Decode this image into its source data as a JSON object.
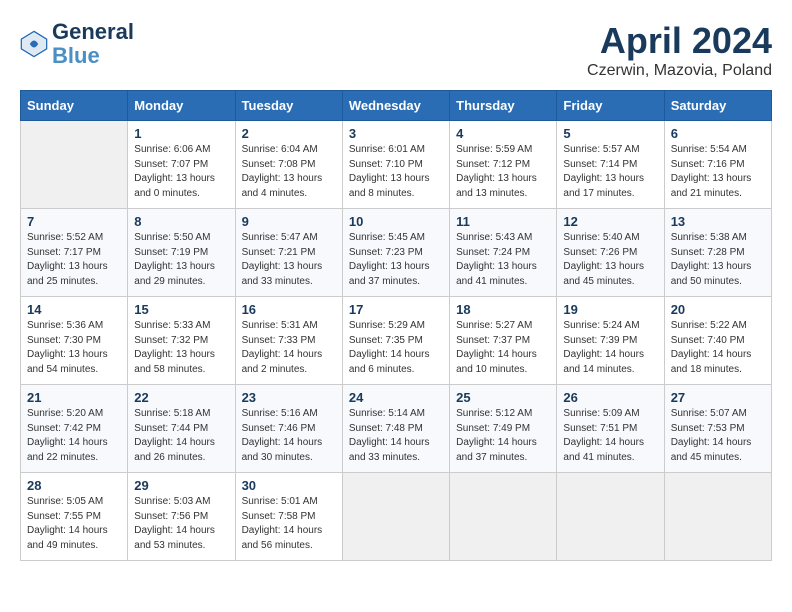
{
  "header": {
    "logo_general": "General",
    "logo_blue": "Blue",
    "month_title": "April 2024",
    "location": "Czerwin, Mazovia, Poland"
  },
  "columns": [
    "Sunday",
    "Monday",
    "Tuesday",
    "Wednesday",
    "Thursday",
    "Friday",
    "Saturday"
  ],
  "weeks": [
    [
      {
        "day": "",
        "info": ""
      },
      {
        "day": "1",
        "info": "Sunrise: 6:06 AM\nSunset: 7:07 PM\nDaylight: 13 hours\nand 0 minutes."
      },
      {
        "day": "2",
        "info": "Sunrise: 6:04 AM\nSunset: 7:08 PM\nDaylight: 13 hours\nand 4 minutes."
      },
      {
        "day": "3",
        "info": "Sunrise: 6:01 AM\nSunset: 7:10 PM\nDaylight: 13 hours\nand 8 minutes."
      },
      {
        "day": "4",
        "info": "Sunrise: 5:59 AM\nSunset: 7:12 PM\nDaylight: 13 hours\nand 13 minutes."
      },
      {
        "day": "5",
        "info": "Sunrise: 5:57 AM\nSunset: 7:14 PM\nDaylight: 13 hours\nand 17 minutes."
      },
      {
        "day": "6",
        "info": "Sunrise: 5:54 AM\nSunset: 7:16 PM\nDaylight: 13 hours\nand 21 minutes."
      }
    ],
    [
      {
        "day": "7",
        "info": "Sunrise: 5:52 AM\nSunset: 7:17 PM\nDaylight: 13 hours\nand 25 minutes."
      },
      {
        "day": "8",
        "info": "Sunrise: 5:50 AM\nSunset: 7:19 PM\nDaylight: 13 hours\nand 29 minutes."
      },
      {
        "day": "9",
        "info": "Sunrise: 5:47 AM\nSunset: 7:21 PM\nDaylight: 13 hours\nand 33 minutes."
      },
      {
        "day": "10",
        "info": "Sunrise: 5:45 AM\nSunset: 7:23 PM\nDaylight: 13 hours\nand 37 minutes."
      },
      {
        "day": "11",
        "info": "Sunrise: 5:43 AM\nSunset: 7:24 PM\nDaylight: 13 hours\nand 41 minutes."
      },
      {
        "day": "12",
        "info": "Sunrise: 5:40 AM\nSunset: 7:26 PM\nDaylight: 13 hours\nand 45 minutes."
      },
      {
        "day": "13",
        "info": "Sunrise: 5:38 AM\nSunset: 7:28 PM\nDaylight: 13 hours\nand 50 minutes."
      }
    ],
    [
      {
        "day": "14",
        "info": "Sunrise: 5:36 AM\nSunset: 7:30 PM\nDaylight: 13 hours\nand 54 minutes."
      },
      {
        "day": "15",
        "info": "Sunrise: 5:33 AM\nSunset: 7:32 PM\nDaylight: 13 hours\nand 58 minutes."
      },
      {
        "day": "16",
        "info": "Sunrise: 5:31 AM\nSunset: 7:33 PM\nDaylight: 14 hours\nand 2 minutes."
      },
      {
        "day": "17",
        "info": "Sunrise: 5:29 AM\nSunset: 7:35 PM\nDaylight: 14 hours\nand 6 minutes."
      },
      {
        "day": "18",
        "info": "Sunrise: 5:27 AM\nSunset: 7:37 PM\nDaylight: 14 hours\nand 10 minutes."
      },
      {
        "day": "19",
        "info": "Sunrise: 5:24 AM\nSunset: 7:39 PM\nDaylight: 14 hours\nand 14 minutes."
      },
      {
        "day": "20",
        "info": "Sunrise: 5:22 AM\nSunset: 7:40 PM\nDaylight: 14 hours\nand 18 minutes."
      }
    ],
    [
      {
        "day": "21",
        "info": "Sunrise: 5:20 AM\nSunset: 7:42 PM\nDaylight: 14 hours\nand 22 minutes."
      },
      {
        "day": "22",
        "info": "Sunrise: 5:18 AM\nSunset: 7:44 PM\nDaylight: 14 hours\nand 26 minutes."
      },
      {
        "day": "23",
        "info": "Sunrise: 5:16 AM\nSunset: 7:46 PM\nDaylight: 14 hours\nand 30 minutes."
      },
      {
        "day": "24",
        "info": "Sunrise: 5:14 AM\nSunset: 7:48 PM\nDaylight: 14 hours\nand 33 minutes."
      },
      {
        "day": "25",
        "info": "Sunrise: 5:12 AM\nSunset: 7:49 PM\nDaylight: 14 hours\nand 37 minutes."
      },
      {
        "day": "26",
        "info": "Sunrise: 5:09 AM\nSunset: 7:51 PM\nDaylight: 14 hours\nand 41 minutes."
      },
      {
        "day": "27",
        "info": "Sunrise: 5:07 AM\nSunset: 7:53 PM\nDaylight: 14 hours\nand 45 minutes."
      }
    ],
    [
      {
        "day": "28",
        "info": "Sunrise: 5:05 AM\nSunset: 7:55 PM\nDaylight: 14 hours\nand 49 minutes."
      },
      {
        "day": "29",
        "info": "Sunrise: 5:03 AM\nSunset: 7:56 PM\nDaylight: 14 hours\nand 53 minutes."
      },
      {
        "day": "30",
        "info": "Sunrise: 5:01 AM\nSunset: 7:58 PM\nDaylight: 14 hours\nand 56 minutes."
      },
      {
        "day": "",
        "info": ""
      },
      {
        "day": "",
        "info": ""
      },
      {
        "day": "",
        "info": ""
      },
      {
        "day": "",
        "info": ""
      }
    ]
  ]
}
